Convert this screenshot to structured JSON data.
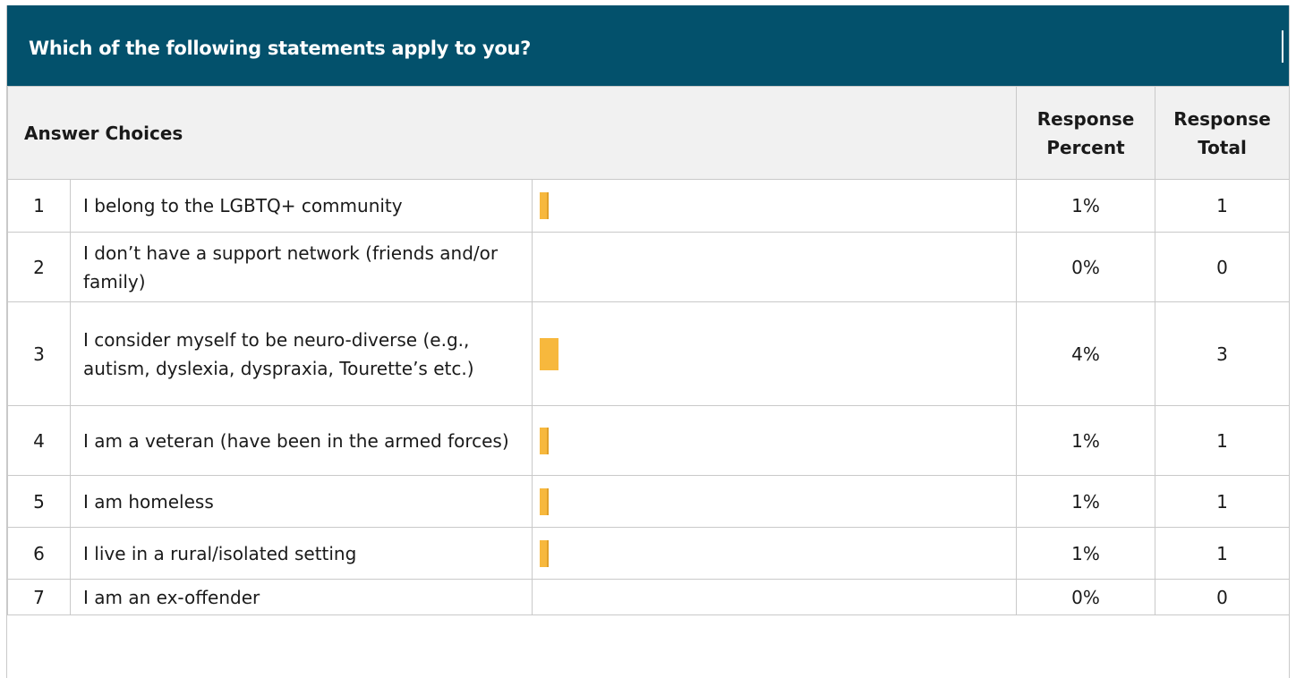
{
  "question": "Which of the following statements apply to you?",
  "header": {
    "answer_choices": "Answer Choices",
    "response_percent": "Response Percent",
    "response_total": "Response Total"
  },
  "accent_color": "#03516c",
  "bar_color": "#f7b83d",
  "rows": [
    {
      "index": "1",
      "label": "I belong to the LGBTQ+ community",
      "percent_label": "1%",
      "percent": 1,
      "total": "1"
    },
    {
      "index": "2",
      "label": "I don’t have a support network (friends and/or family)",
      "percent_label": "0%",
      "percent": 0,
      "total": "0"
    },
    {
      "index": "3",
      "label": "I consider myself to be neuro-diverse (e.g., autism, dyslexia, dyspraxia, Tourette’s etc.)",
      "percent_label": "4%",
      "percent": 4,
      "total": "3"
    },
    {
      "index": "4",
      "label": "I am a veteran (have been in the armed forces)",
      "percent_label": "1%",
      "percent": 1,
      "total": "1"
    },
    {
      "index": "5",
      "label": "I am homeless",
      "percent_label": "1%",
      "percent": 1,
      "total": "1"
    },
    {
      "index": "6",
      "label": "I live in a rural/isolated setting",
      "percent_label": "1%",
      "percent": 1,
      "total": "1"
    },
    {
      "index": "7",
      "label": "I am an ex-offender",
      "percent_label": "0%",
      "percent": 0,
      "total": "0"
    }
  ]
}
